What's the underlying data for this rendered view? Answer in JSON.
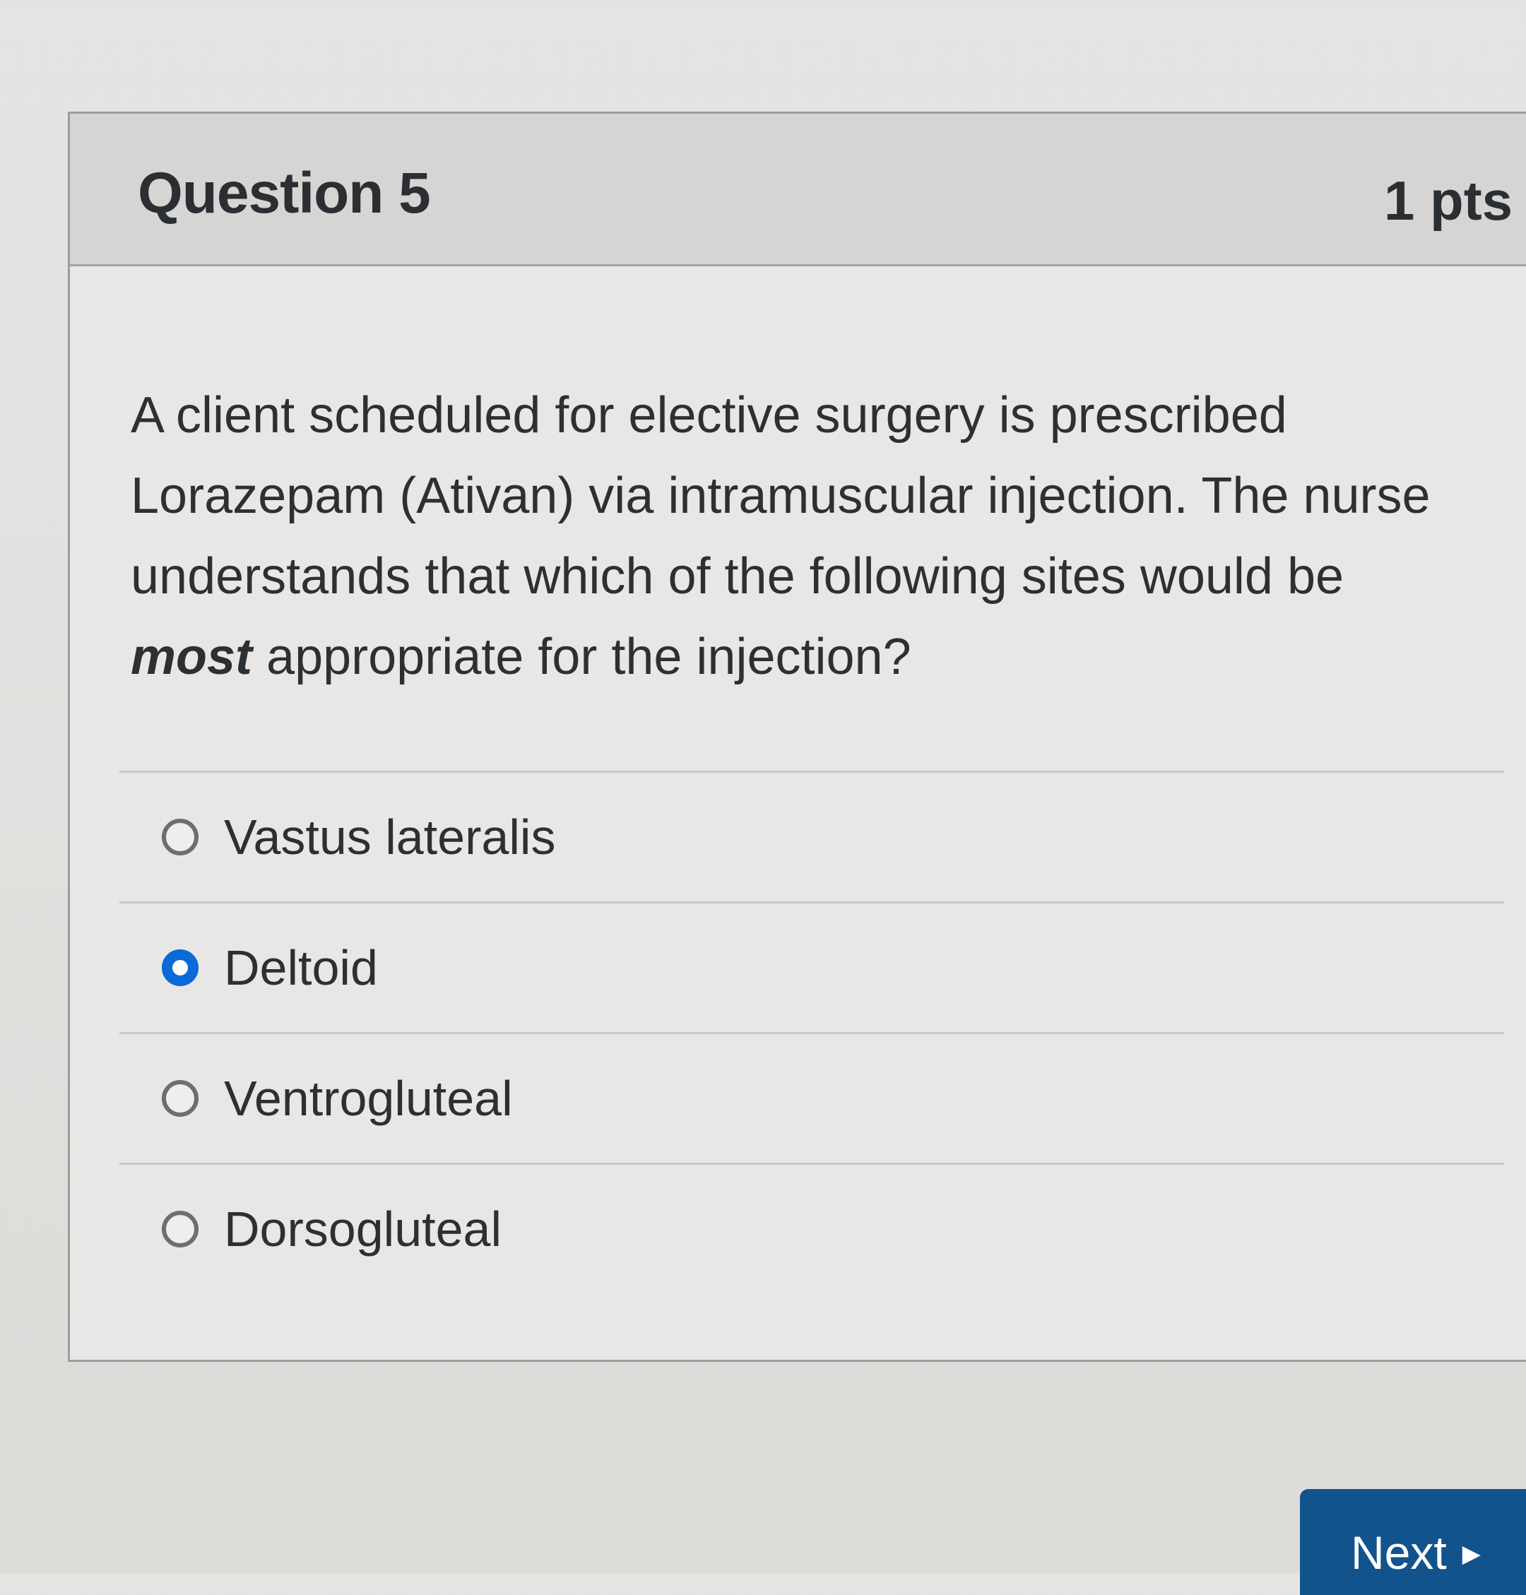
{
  "question": {
    "title": "Question 5",
    "points": "1 pts",
    "text_lines": {
      "line1": "A client scheduled for elective surgery is prescribed",
      "line2": "Lorazepam (Ativan) via intramuscular injection.  The nurse",
      "line3": "understands that which of the following sites would be",
      "line4_emphasis": "most",
      "line4_rest": " appropriate for the injection?"
    }
  },
  "answers": [
    {
      "label": "Vastus lateralis",
      "selected": false
    },
    {
      "label": "Deltoid",
      "selected": true
    },
    {
      "label": "Ventrogluteal",
      "selected": false
    },
    {
      "label": "Dorsogluteal",
      "selected": false
    }
  ],
  "navigation": {
    "next_label": "Next",
    "next_icon": "caret-right-icon"
  },
  "colors": {
    "selected_radio": "#0a6ad6",
    "next_button": "#12538e"
  }
}
